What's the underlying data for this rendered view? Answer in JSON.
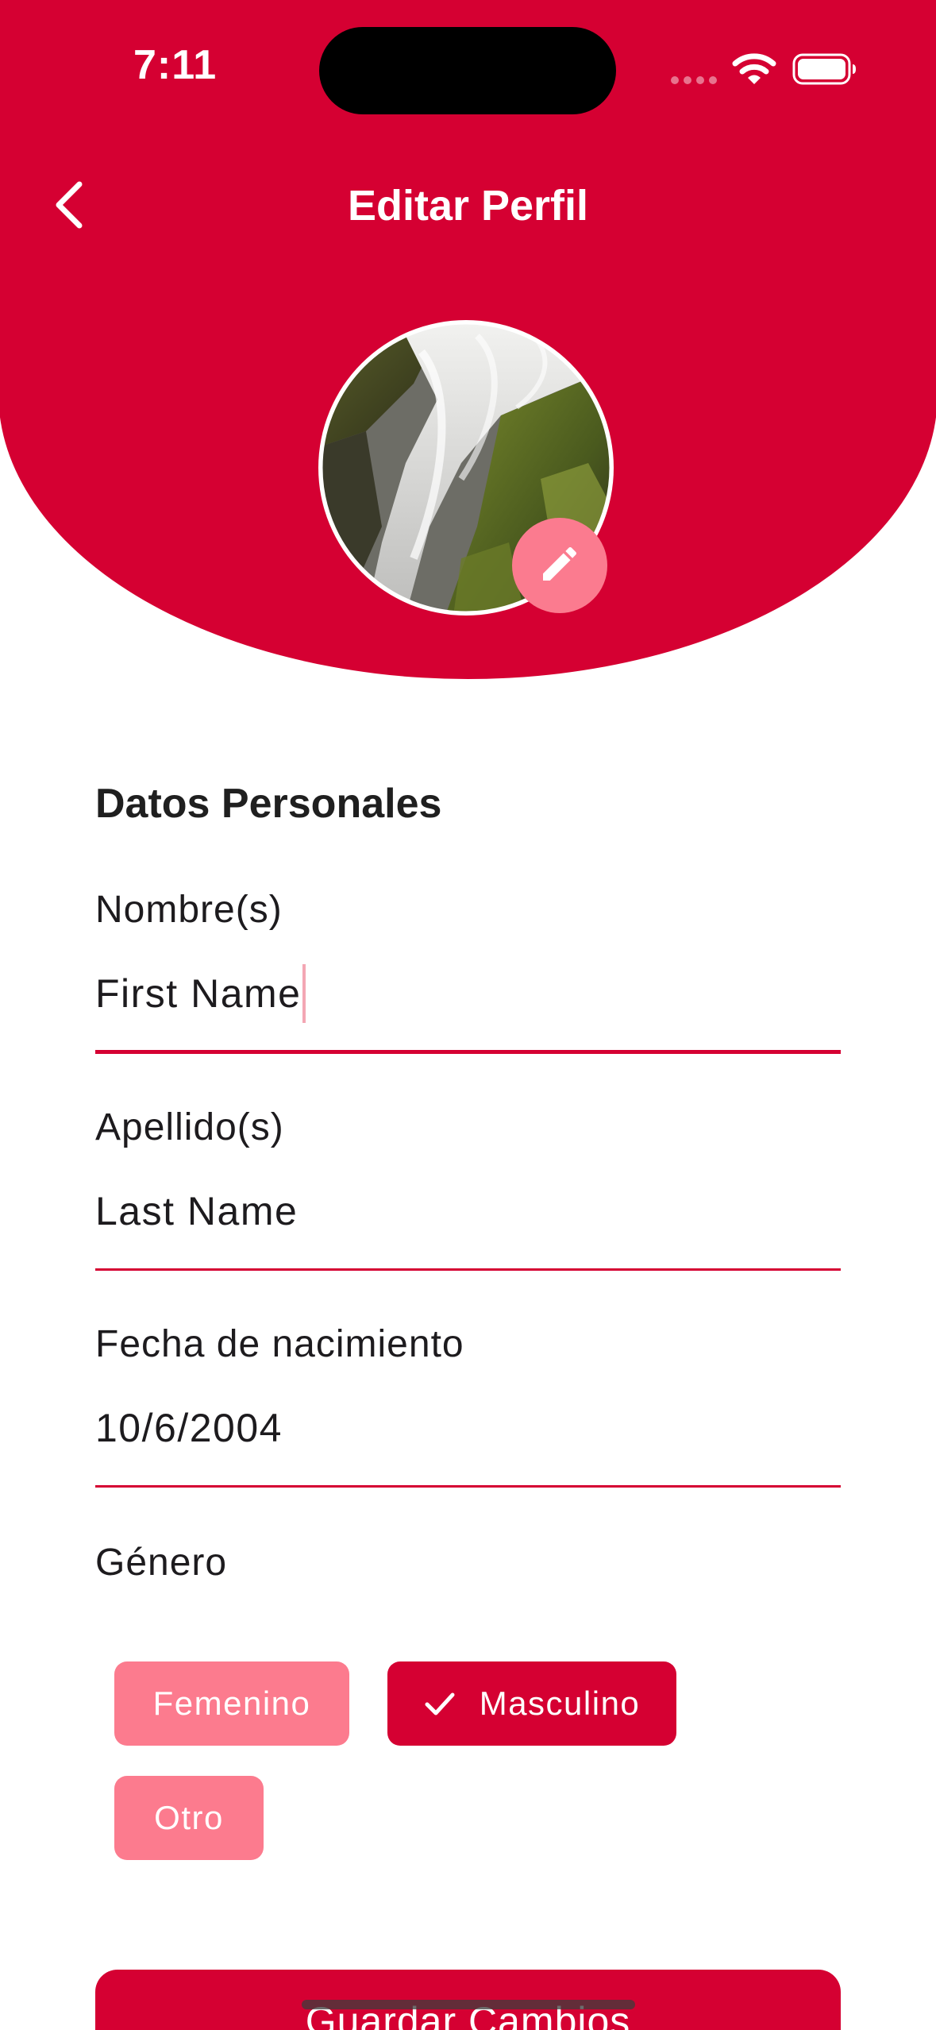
{
  "status_bar": {
    "time": "7:11"
  },
  "header": {
    "title": "Editar Perfil",
    "back_icon": "chevron-left-icon",
    "edit_icon": "pencil-icon"
  },
  "colors": {
    "primary": "#d50032",
    "chip_light": "#fc7b8e",
    "fab": "#fb7b8f",
    "background": "#ffffff"
  },
  "form": {
    "section_title": "Datos Personales",
    "first_name": {
      "label": "Nombre(s)",
      "value": "First Name"
    },
    "last_name": {
      "label": "Apellido(s)",
      "value": "Last Name"
    },
    "birth_date": {
      "label": "Fecha de nacimiento",
      "value": "10/6/2004"
    },
    "gender": {
      "label": "Género",
      "options": [
        "Femenino",
        "Masculino",
        "Otro"
      ],
      "selected": "Masculino"
    }
  },
  "actions": {
    "save_label": "Guardar Cambios"
  }
}
